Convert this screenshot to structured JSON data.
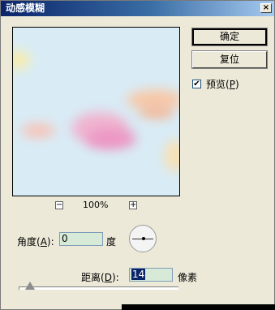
{
  "window": {
    "title": "动感模糊",
    "close_glyph": "×"
  },
  "buttons": {
    "ok": "确定",
    "reset": "复位"
  },
  "preview_toggle": {
    "checked": true,
    "label_prefix": "预览(",
    "mnemonic": "P",
    "label_suffix": ")",
    "check_glyph": "✔"
  },
  "zoom": {
    "level": "100%",
    "minus": "−",
    "plus": "+"
  },
  "angle": {
    "label_prefix": "角度(",
    "mnemonic": "A",
    "label_suffix": "):",
    "value": "0",
    "unit": "度"
  },
  "distance": {
    "label_prefix": "距离(",
    "mnemonic": "D",
    "label_suffix": "):",
    "value": "14",
    "unit": "像素",
    "slider_fraction": 0.07
  },
  "colors": {
    "title_start": "#0a246a",
    "title_end": "#a6caf0",
    "field_bg": "#d7ead8",
    "preview_bg": "#d9ecf6"
  }
}
